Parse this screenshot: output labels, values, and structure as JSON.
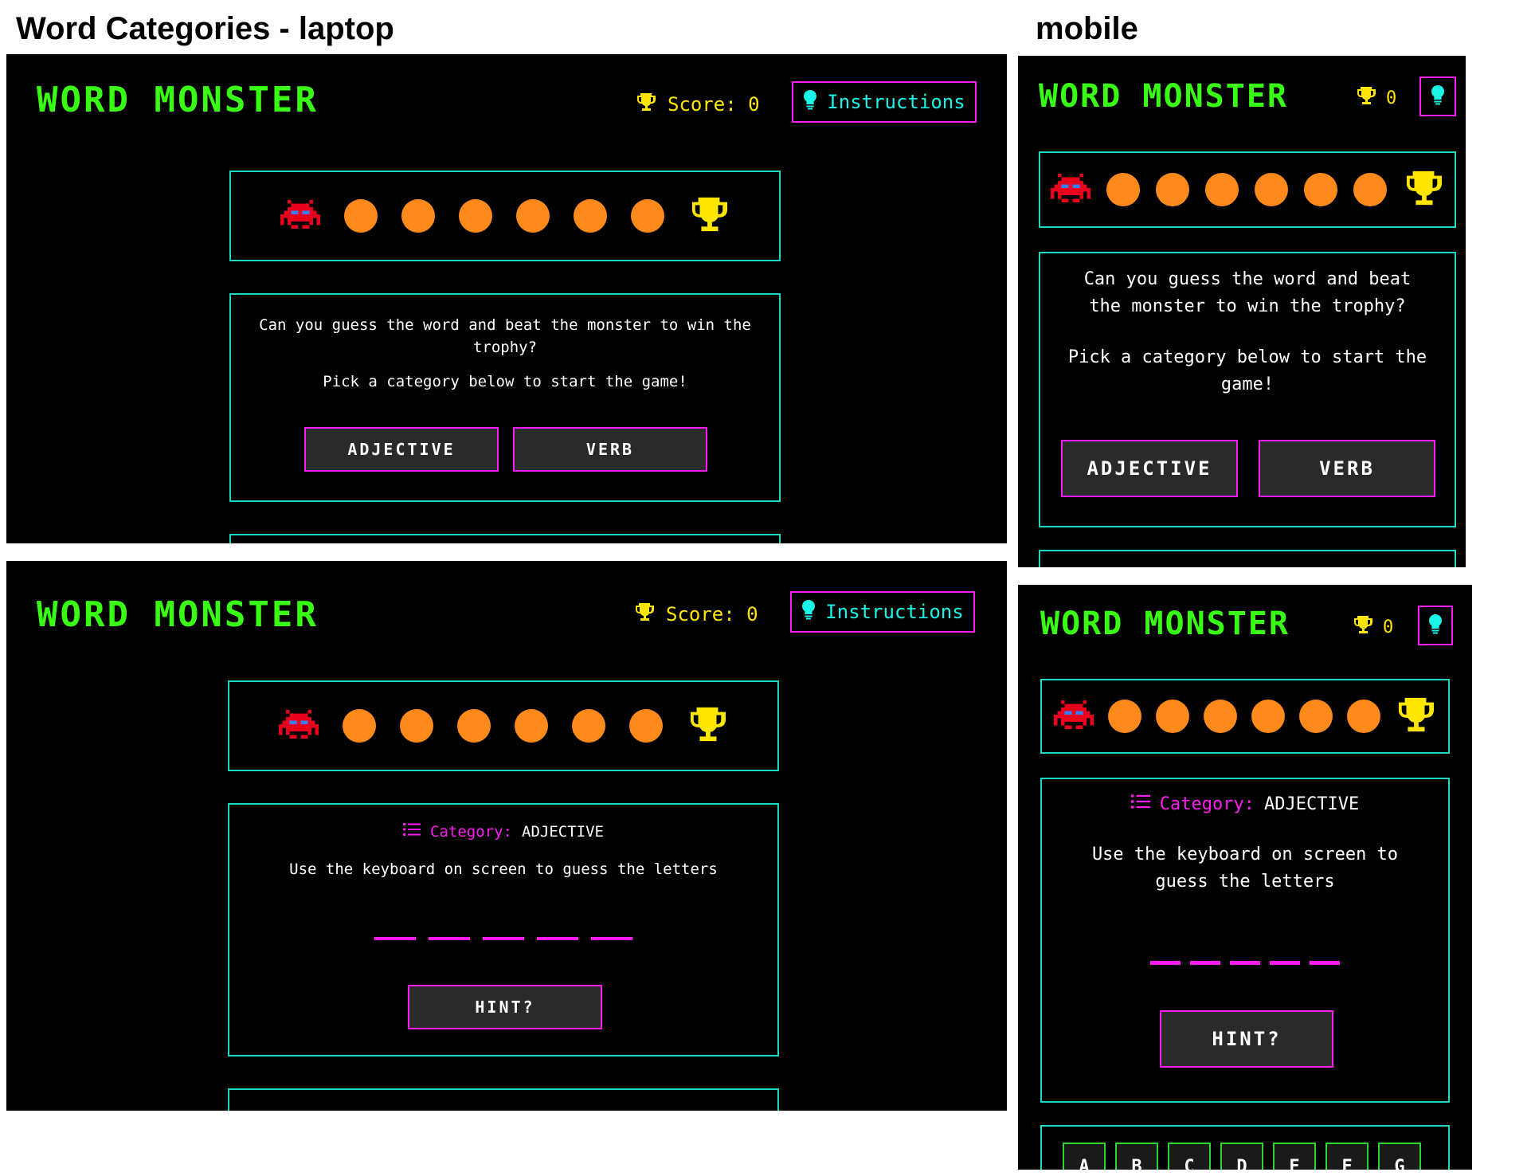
{
  "headings": {
    "laptop": "Word Categories - laptop",
    "mobile": "mobile"
  },
  "app": {
    "logo": "WORD MONSTER",
    "score_label": "Score: 0",
    "score_value": "0",
    "instructions_label": "Instructions"
  },
  "progress": {
    "pellets": 6
  },
  "start": {
    "prompt_line1": "Can you guess the word and beat the monster to win the trophy?",
    "prompt_line2": "Pick a category below to start the game!",
    "mobile_prompt_a": "Can you guess the word and beat",
    "mobile_prompt_b": "the monster to win the trophy?",
    "mobile_prompt_c": "Pick a category below to start the",
    "mobile_prompt_d": "game!",
    "adjective_label": "ADJECTIVE",
    "verb_label": "VERB"
  },
  "game": {
    "category_label": "Category:",
    "category_value": "ADJECTIVE",
    "instruction": "Use the keyboard on screen to guess the letters",
    "mobile_instruction_a": "Use the keyboard on screen to",
    "mobile_instruction_b": "guess the letters",
    "word_length": 5,
    "hint_label": "HINT?"
  },
  "keyboard": {
    "keys": [
      "A",
      "B",
      "C",
      "D",
      "E",
      "F",
      "G"
    ]
  },
  "colors": {
    "logo": "#39ff14",
    "accent_pink": "#ff1cf0",
    "accent_cyan": "#19f5e6",
    "panel_border": "#19d9c2",
    "pellet": "#ff8a1c",
    "trophy": "#ffe600",
    "monster": "#e8001c"
  },
  "icons": {
    "score": "trophy-icon",
    "instructions": "lightbulb-icon",
    "category": "list-icon",
    "monster": "space-invader-monster-icon",
    "goal": "trophy-icon"
  }
}
